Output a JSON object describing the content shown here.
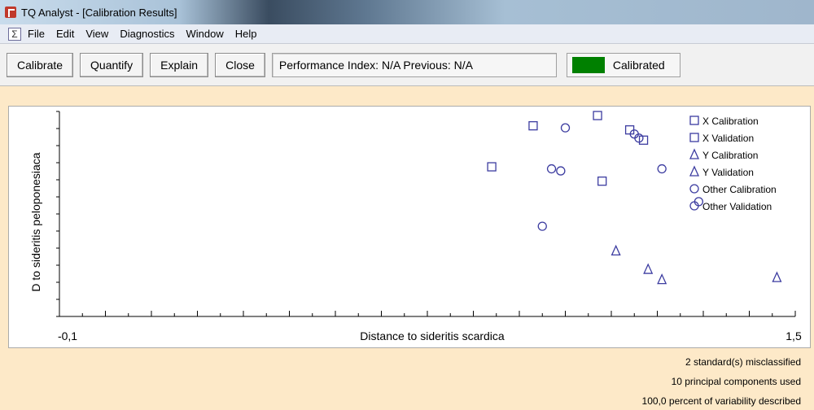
{
  "window": {
    "title": "TQ Analyst  - [Calibration Results]"
  },
  "menu": [
    "File",
    "Edit",
    "View",
    "Diagnostics",
    "Window",
    "Help"
  ],
  "toolbar": {
    "calibrate": "Calibrate",
    "quantify": "Quantify",
    "explain": "Explain",
    "close": "Close",
    "performance": "Performance Index:  N/A  Previous:  N/A",
    "status": "Calibrated",
    "status_color": "#008000"
  },
  "chart_data": {
    "type": "scatter",
    "xlabel": "Distance to sideritis scardica",
    "ylabel": "D to sideritis peloponesiaca",
    "x_tick_labels": [
      "-0,1",
      "1,5"
    ],
    "xlim": [
      -0.1,
      1.5
    ],
    "ylim": [
      0,
      1
    ],
    "marker_color": "#3c3ca0",
    "series": [
      {
        "name": "X Calibration",
        "marker": "square",
        "points": [
          [
            0.84,
            0.73
          ],
          [
            1.07,
            0.98
          ],
          [
            1.14,
            0.91
          ],
          [
            1.08,
            0.66
          ],
          [
            1.17,
            0.86
          ],
          [
            0.93,
            0.93
          ]
        ]
      },
      {
        "name": "X Validation",
        "marker": "square",
        "points": []
      },
      {
        "name": "Y Calibration",
        "marker": "triangle",
        "points": [
          [
            1.11,
            0.32
          ],
          [
            1.18,
            0.23
          ],
          [
            1.21,
            0.18
          ],
          [
            1.46,
            0.19
          ]
        ]
      },
      {
        "name": "Y Validation",
        "marker": "triangle",
        "points": []
      },
      {
        "name": "Other Calibration",
        "marker": "circle",
        "points": [
          [
            1.0,
            0.92
          ],
          [
            0.97,
            0.72
          ],
          [
            0.99,
            0.71
          ],
          [
            1.15,
            0.89
          ],
          [
            1.16,
            0.87
          ],
          [
            0.95,
            0.44
          ],
          [
            1.21,
            0.72
          ],
          [
            1.29,
            0.56
          ]
        ]
      },
      {
        "name": "Other Validation",
        "marker": "circle",
        "points": []
      }
    ]
  },
  "info_lines": [
    "2 standard(s) misclassified",
    "10 principal components used",
    "100,0 percent of variability described"
  ]
}
